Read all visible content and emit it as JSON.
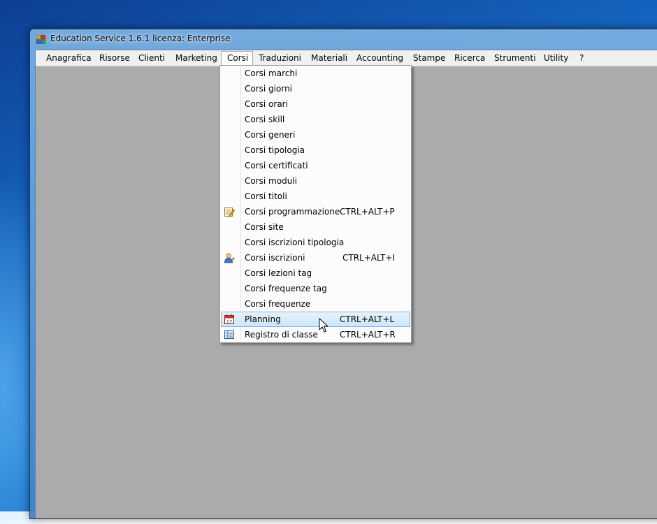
{
  "window": {
    "title": "Education Service 1.6.1 licenza: Enterprise"
  },
  "menubar": {
    "items": [
      {
        "label": "Anagrafica"
      },
      {
        "label": "Risorse"
      },
      {
        "label": "Clienti"
      },
      {
        "label": "Marketing"
      },
      {
        "label": "Corsi"
      },
      {
        "label": "Traduzioni"
      },
      {
        "label": "Materiali"
      },
      {
        "label": "Accounting"
      },
      {
        "label": "Stampe"
      },
      {
        "label": "Ricerca"
      },
      {
        "label": "Strumenti"
      },
      {
        "label": "Utility"
      },
      {
        "label": "?"
      }
    ],
    "open_menu": "Corsi"
  },
  "dropdown": {
    "items": [
      {
        "label": "Corsi marchi",
        "shortcut": ""
      },
      {
        "label": "Corsi giorni",
        "shortcut": ""
      },
      {
        "label": "Corsi orari",
        "shortcut": ""
      },
      {
        "label": "Corsi skill",
        "shortcut": ""
      },
      {
        "label": "Corsi generi",
        "shortcut": ""
      },
      {
        "label": "Corsi tipologia",
        "shortcut": ""
      },
      {
        "label": "Corsi certificati",
        "shortcut": ""
      },
      {
        "label": "Corsi moduli",
        "shortcut": ""
      },
      {
        "label": "Corsi titoli",
        "shortcut": ""
      },
      {
        "label": "Corsi programmazione",
        "shortcut": "CTRL+ALT+P",
        "icon": "schedule-edit-icon"
      },
      {
        "label": "Corsi site",
        "shortcut": ""
      },
      {
        "label": "Corsi iscrizioni tipologia",
        "shortcut": ""
      },
      {
        "label": "Corsi iscrizioni",
        "shortcut": "CTRL+ALT+I",
        "icon": "user-enroll-icon"
      },
      {
        "label": "Corsi lezioni tag",
        "shortcut": ""
      },
      {
        "label": "Corsi frequenze tag",
        "shortcut": ""
      },
      {
        "label": "Corsi frequenze",
        "shortcut": ""
      },
      {
        "label": "Planning",
        "shortcut": "CTRL+ALT+L",
        "icon": "calendar-icon",
        "highlighted": true
      },
      {
        "label": "Registro di classe",
        "shortcut": "CTRL+ALT+R",
        "icon": "register-icon"
      }
    ]
  },
  "colors": {
    "client_background": "#ababab",
    "menubar_background": "#f0f0f0",
    "highlight_border": "#7eb4ea",
    "desktop_blue": "#1565c0"
  }
}
